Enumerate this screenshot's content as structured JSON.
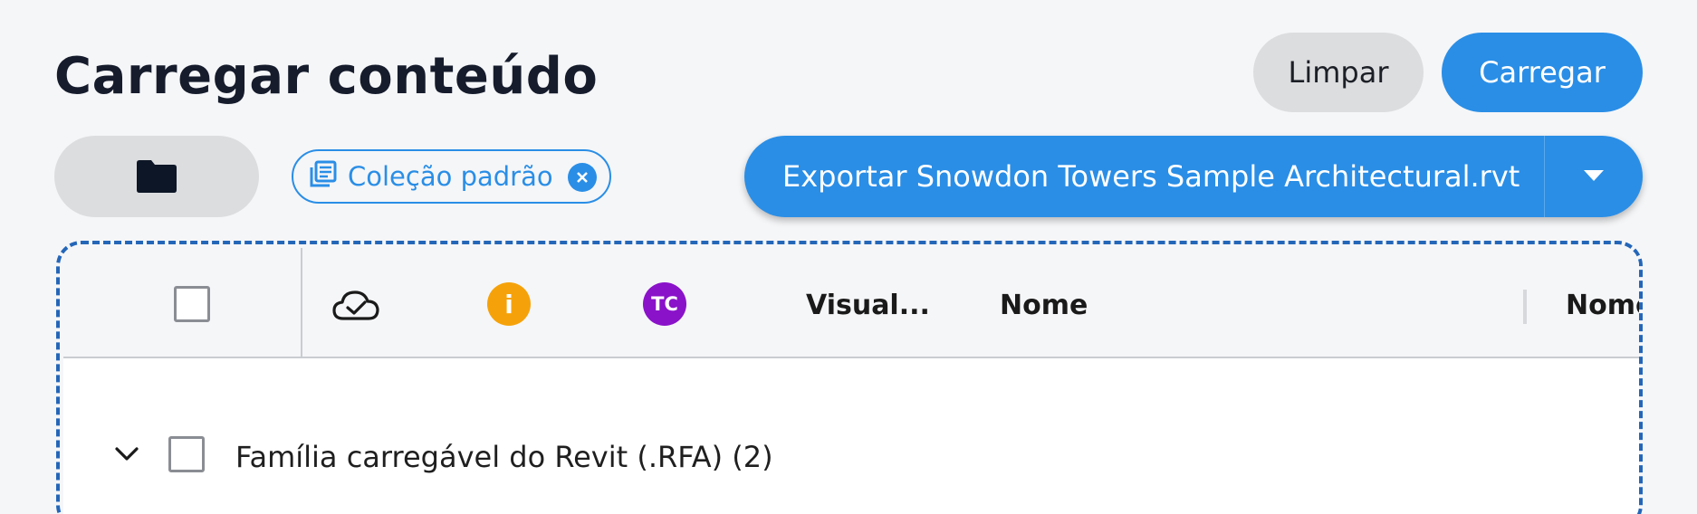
{
  "header": {
    "title": "Carregar conteúdo",
    "clear_label": "Limpar",
    "load_label": "Carregar"
  },
  "toolbar": {
    "folder_icon": "folder-icon",
    "collection_chip": {
      "icon": "library-icon",
      "label": "Coleção padrão",
      "remove_icon": "close-circle-icon"
    },
    "export_button": {
      "label": "Exportar Snowdon Towers Sample Architectural.rvt",
      "dropdown_icon": "caret-down-icon"
    }
  },
  "grid": {
    "columns": [
      {
        "type": "checkbox"
      },
      {
        "type": "icon",
        "icon": "cloud-check-icon"
      },
      {
        "type": "badge",
        "text": "i",
        "color": "#f5a20a"
      },
      {
        "type": "badge",
        "text": "TC",
        "color": "#8a12c9"
      },
      {
        "type": "text",
        "label": "Visual..."
      },
      {
        "type": "text",
        "label": "Nome"
      },
      {
        "type": "text",
        "label": "Nome"
      }
    ],
    "groups": [
      {
        "label": "Família carregável do Revit (.RFA) (2)",
        "expanded": true
      }
    ]
  },
  "colors": {
    "accent": "#2a8ee6",
    "dropzone_border": "#2466b8",
    "neutral_button": "#dcdddf"
  }
}
